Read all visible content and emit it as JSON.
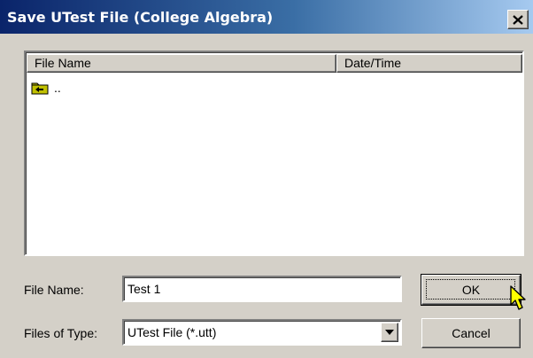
{
  "window": {
    "title": "Save UTest File (College Algebra)"
  },
  "list": {
    "columns": [
      "File Name",
      "Date/Time"
    ],
    "items": [
      {
        "name": "..",
        "icon": "folder-up-icon"
      }
    ]
  },
  "form": {
    "file_name_label": "File Name:",
    "file_name_value": "Test 1",
    "file_type_label": "Files of Type:",
    "file_type_value": "UTest File (*.utt)"
  },
  "buttons": {
    "ok_label": "OK",
    "cancel_label": "Cancel"
  }
}
